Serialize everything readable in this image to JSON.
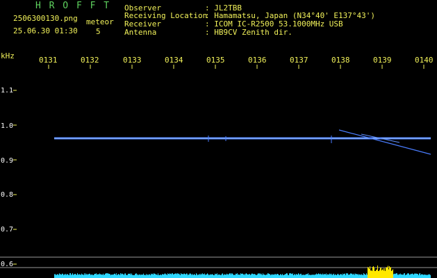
{
  "header": {
    "logo": "H R O F F T",
    "filename": "2506300130.png",
    "datetime": "25.06.30 01:30",
    "meteor_label": "meteor",
    "meteor_count": "5",
    "info": [
      {
        "key": "Observer",
        "value": ": JL2TBB"
      },
      {
        "key": "Receiving Location",
        "value": ": Hamamatsu, Japan (N34°40' E137°43')"
      },
      {
        "key": "Receiver",
        "value": ": ICOM IC-R2500 53.1000MHz USB"
      },
      {
        "key": "Antenna",
        "value": ": HB9CV Zenith dir."
      }
    ]
  },
  "axis": {
    "y_unit": "kHz",
    "y_ticks": [
      "1.1",
      "1.0",
      "0.9",
      "0.8",
      "0.7",
      "0.6"
    ],
    "x_ticks": [
      "0131",
      "0132",
      "0133",
      "0134",
      "0135",
      "0136",
      "0137",
      "0138",
      "0139",
      "0140"
    ]
  },
  "colors": {
    "green": "#5fd35f",
    "yellow": "#f2f25a",
    "signal": "#4a7dff",
    "signal_core": "#9fc7ff",
    "level": "#2fd7ff",
    "level_peak": "#ffe800",
    "guide": "#9a9a9a"
  }
}
